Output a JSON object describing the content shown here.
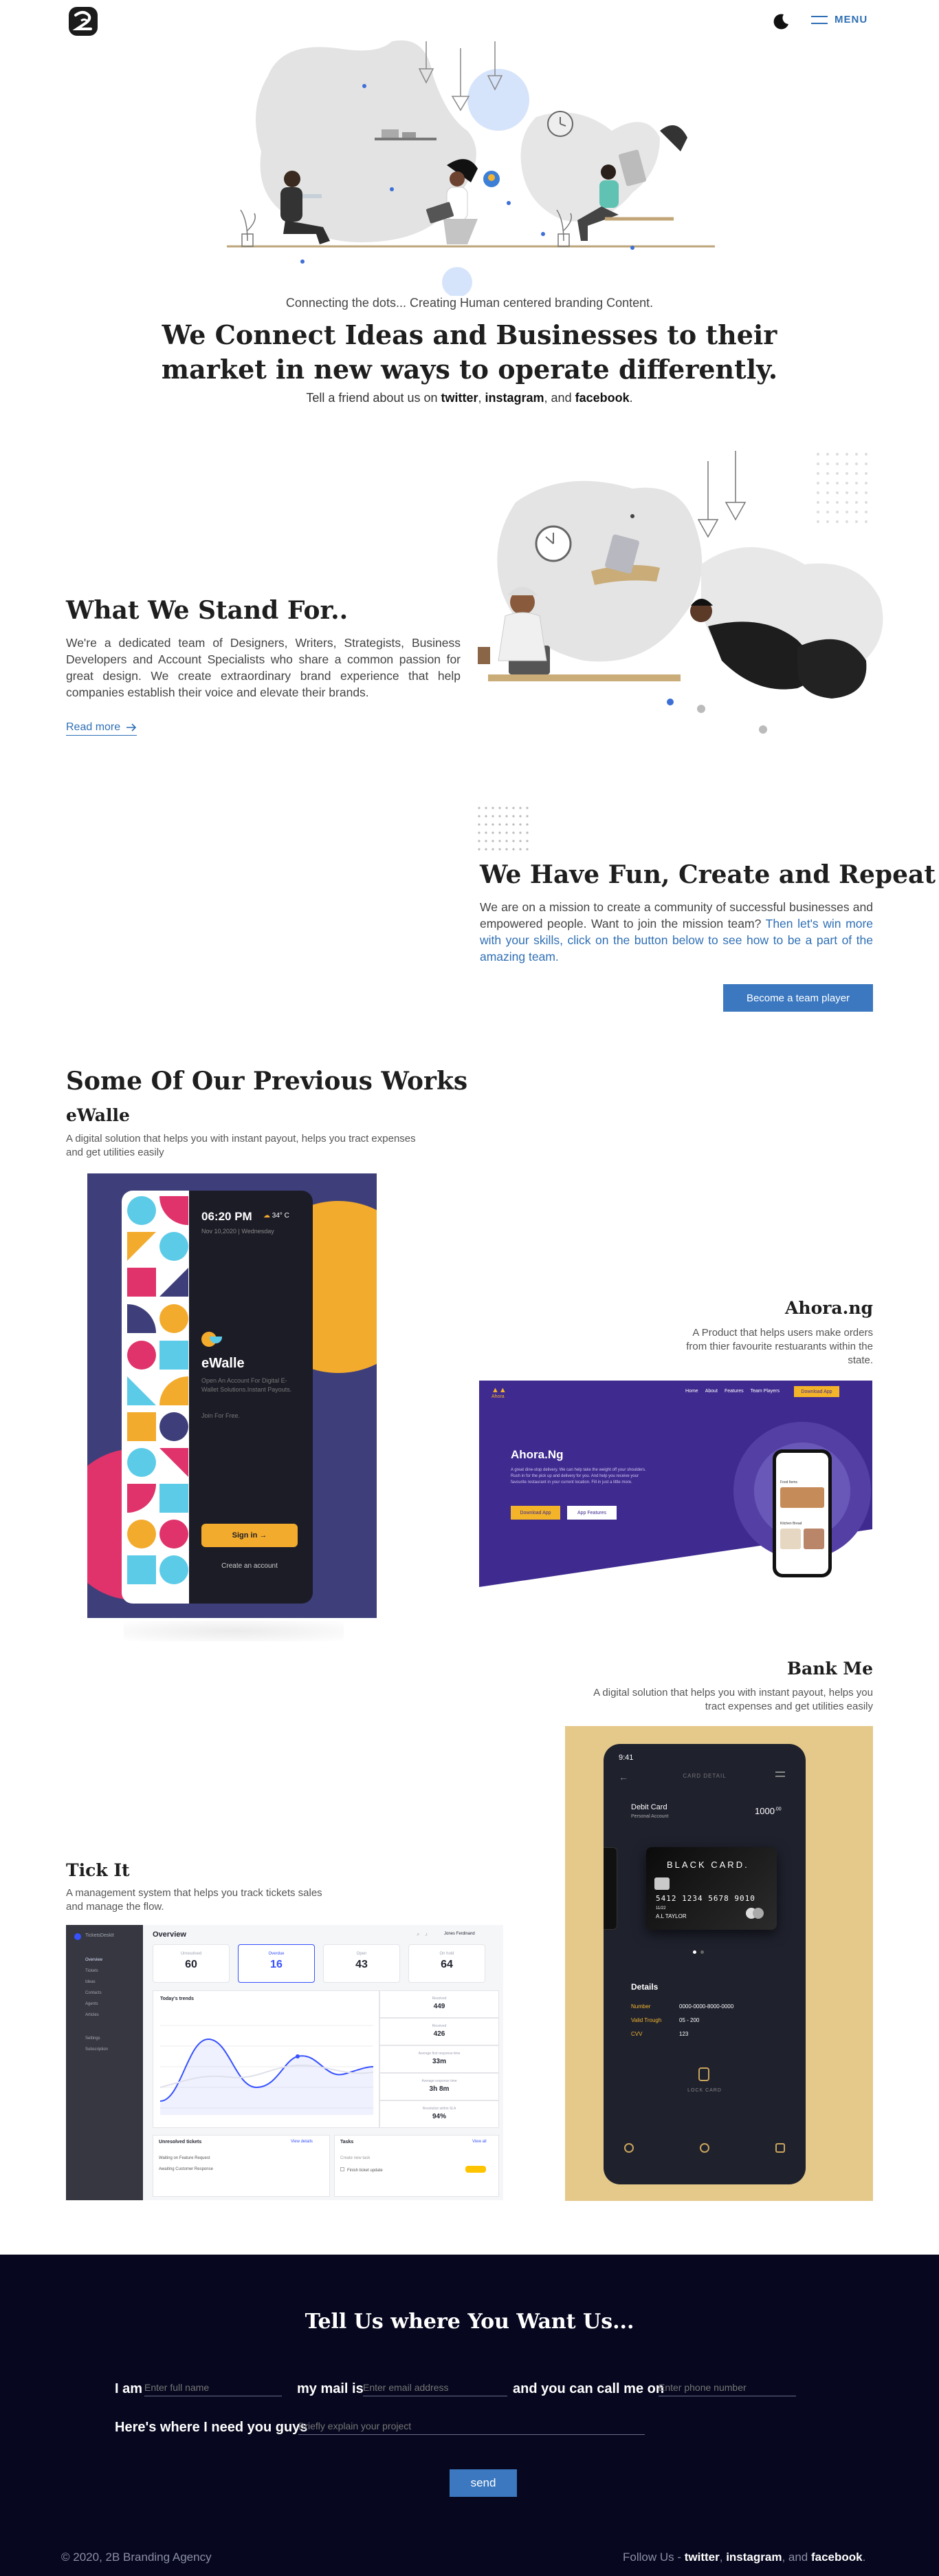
{
  "header": {
    "menu_label": "MENU"
  },
  "hero": {
    "tagline": "Connecting the dots... Creating Human centered branding Content.",
    "title": "We Connect Ideas and Businesses to their market in new ways to operate differently.",
    "share_prefix": "Tell a friend about us on ",
    "share_twitter": "twitter",
    "share_sep1": ", ",
    "share_instagram": "instagram",
    "share_sep2": ", and ",
    "share_facebook": "facebook",
    "share_end": "."
  },
  "stand": {
    "title": "What We Stand For..",
    "text": "We're a dedicated team of Designers, Writers, Strategists, Business Developers and Account Specialists who share a common passion for great design. We create extraordinary brand experience that help companies establish their voice and elevate their brands.",
    "read_more": "Read more"
  },
  "fun": {
    "title": "We Have Fun, Create and Repeat",
    "text": "We are on a mission to create a community of successful businesses and empowered people. Want to join the mission team?",
    "text_blue": "Then let's win more with your skills, click on the button below to see how to be a part of the amazing team.",
    "button": "Become a team player"
  },
  "works": {
    "title": "Some Of Our Previous Works",
    "projects": [
      {
        "name": "eWalle",
        "desc": "A digital solution that helps you with instant payout, helps you tract expenses and get utilities easily"
      },
      {
        "name": "Ahora.ng",
        "desc": "A Product that helps users make orders from thier favourite restuarants within the state."
      },
      {
        "name": "Bank Me",
        "desc": "A digital solution that helps you with instant payout, helps you tract expenses and get utilities easily"
      },
      {
        "name": "Tick It",
        "desc": "A management system that helps you track tickets sales and manage the flow."
      }
    ]
  },
  "ewalle_mock": {
    "time": "06:20 PM",
    "weather": "34° C",
    "date": "Nov 10,2020 | Wednesday",
    "app": "eWalle",
    "tagline": "Open An Account For Digital E-Wallet Solutions.Instant Payouts.",
    "join": "Join For Free.",
    "signin": "Sign in",
    "create": "Create an account"
  },
  "ahora_mock": {
    "brand": "Ahora",
    "nav": [
      "Home",
      "About",
      "Features",
      "Team Players"
    ],
    "nav_cta": "Download App",
    "title": "Ahora.Ng",
    "text": "A great dine-stop delivery. We can help take the weight off your shoulders. Rush in for the pick up and delivery for you. And help you receive your favourite restaurant in your current location. Fill in just a little more.",
    "btn1": "Download App",
    "btn2": "App Features",
    "phone_label1": "Food Items",
    "phone_label2": "Kitchen Bread"
  },
  "bankme_mock": {
    "time": "9:41",
    "header": "CARD DETAIL",
    "card_type": "Debit Card",
    "account": "Personal Account",
    "balance": "1000",
    "balance_sup": ".00",
    "card_brand": "BLACK CARD.",
    "card_number": "5412  1234  5678  9010",
    "card_expiry": "11/22",
    "card_holder": "A.L TAYLOR",
    "details_title": "Details",
    "rows": [
      {
        "k": "Number",
        "v": "0000-0000-8000-0000"
      },
      {
        "k": "Valid Trough",
        "v": "05 - 200"
      },
      {
        "k": "CVV",
        "v": "123"
      }
    ],
    "lock": "LOCK CARD"
  },
  "tickit_mock": {
    "brand": "TicketsDeskIt",
    "sidebar": [
      "Overview",
      "Tickets",
      "Ideas",
      "Contacts",
      "Agents",
      "Articles",
      "Settings",
      "Subscription"
    ],
    "title": "Overview",
    "user": "Jones Ferdinand",
    "stats": [
      {
        "label": "Unresolved",
        "value": "60"
      },
      {
        "label": "Overdue",
        "value": "16"
      },
      {
        "label": "Open",
        "value": "43"
      },
      {
        "label": "On hold",
        "value": "64"
      }
    ],
    "chart_title": "Today's trends",
    "side_stats": [
      {
        "label": "Resolved",
        "value": "449"
      },
      {
        "label": "Received",
        "value": "426"
      },
      {
        "label": "Average first response time",
        "value": "33m"
      },
      {
        "label": "Average response time",
        "value": "3h 8m"
      },
      {
        "label": "Resolution within SLA",
        "value": "94%"
      }
    ],
    "bottom_left": "Unresolved tickets",
    "bottom_left_link": "View details",
    "bottom_left_rows": [
      "Waiting on Feature Request",
      "Awaiting Customer Response"
    ],
    "bottom_right": "Tasks",
    "bottom_right_link": "View all",
    "bottom_right_rows": [
      "Create new task",
      "Finish ticket update"
    ]
  },
  "contact": {
    "title": "Tell Us where You Want Us...",
    "i_am": "I am",
    "name_ph": "Enter full name",
    "mail_is": "my mail is",
    "email_ph": "Enter email address",
    "call_me": "and you can call me on",
    "phone_ph": "Enter phone number",
    "need_you": "Here's where I need you guys",
    "project_ph": "Briefly explain your project",
    "send": "send"
  },
  "footer": {
    "copyright": "© 2020, 2B Branding Agency",
    "follow": "Follow Us - ",
    "twitter": "twitter",
    "instagram": "instagram",
    "and": ", and ",
    "comma": ", ",
    "facebook": "facebook",
    "end": "."
  },
  "colors": {
    "accent": "#3b78c0",
    "link": "#2f6fb5",
    "footer_bg": "#07081f",
    "ewalle_bg": "#3e3f7a",
    "ewalle_yellow": "#f3ab2d",
    "ahora_purple": "#3f2a8f",
    "bankme_bg": "#e5c98b"
  }
}
